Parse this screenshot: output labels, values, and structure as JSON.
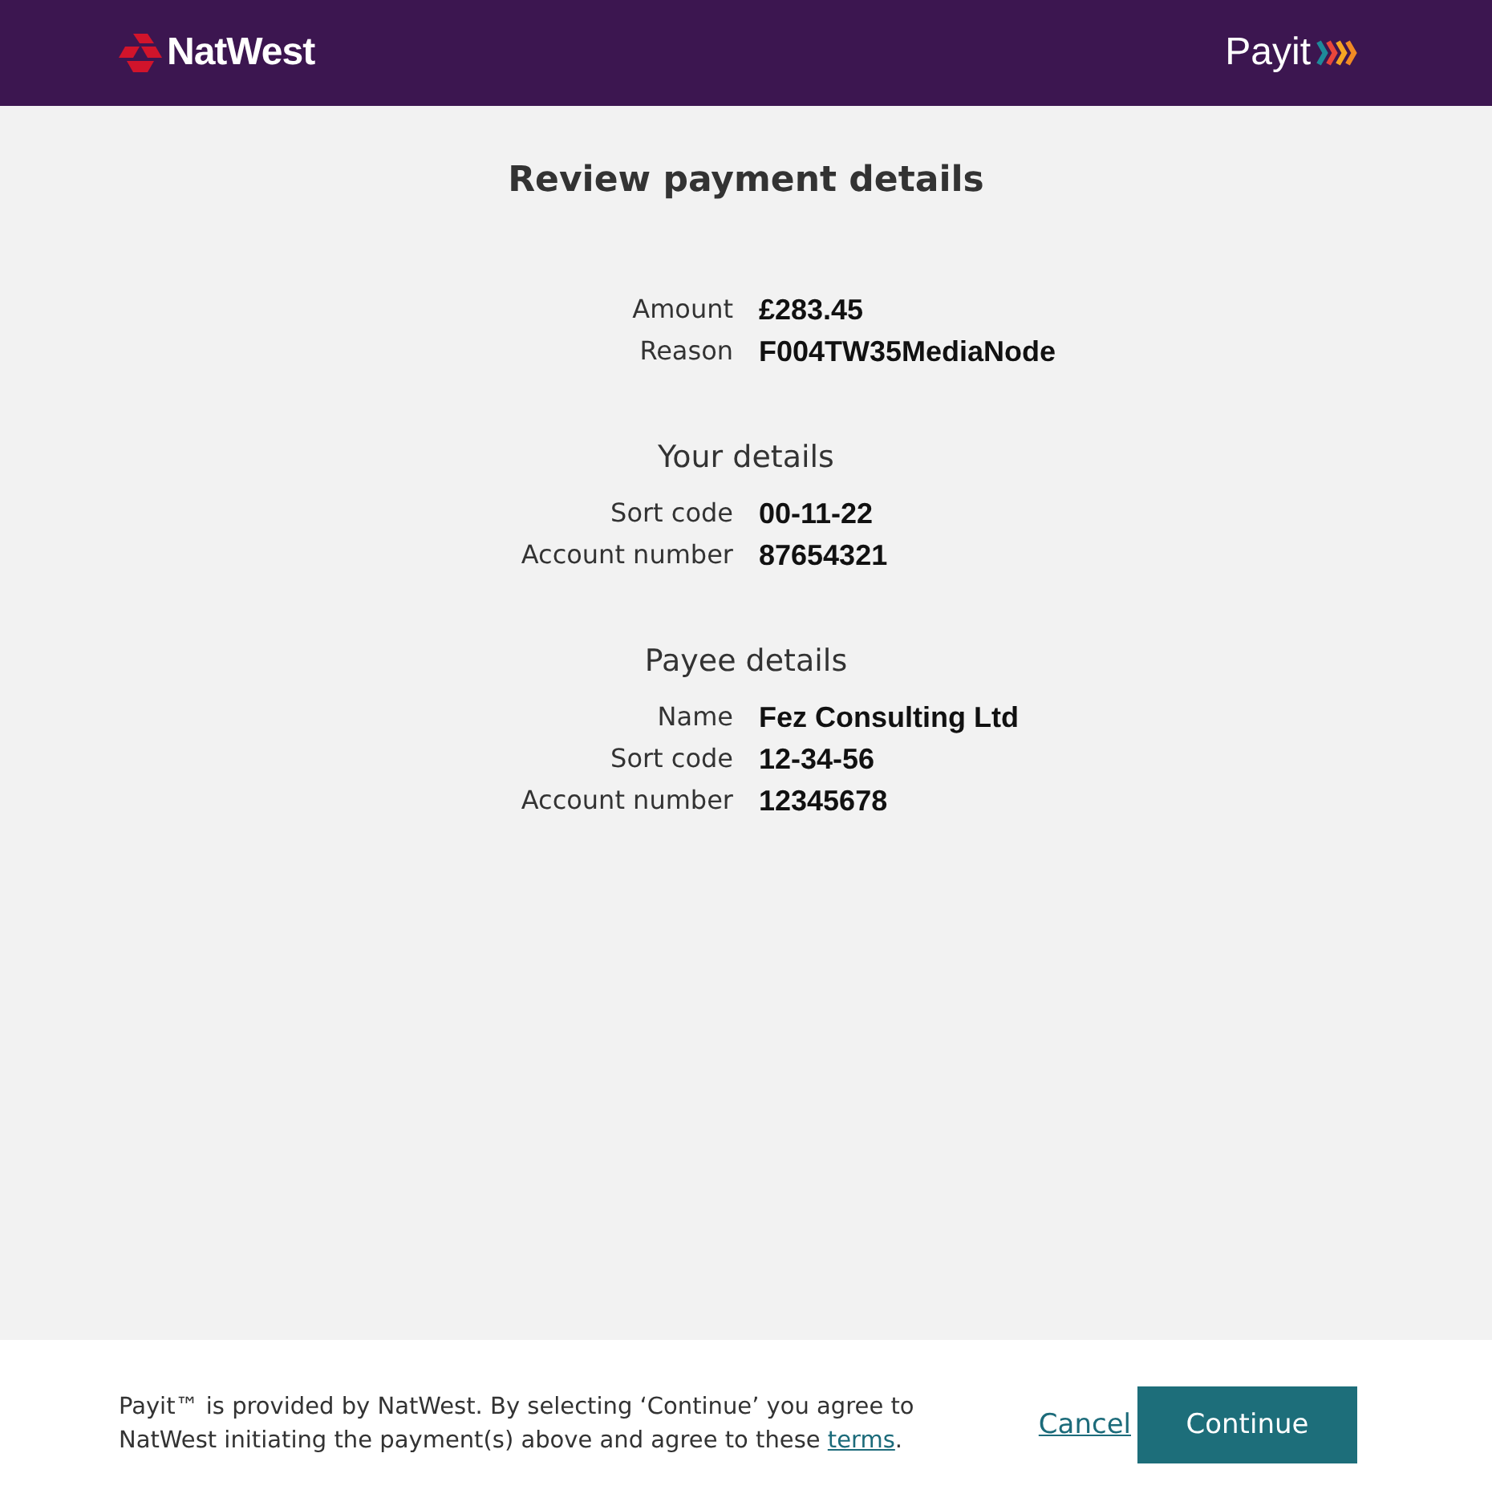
{
  "header": {
    "bank_name": "NatWest",
    "service_name": "Payit"
  },
  "title": "Review payment details",
  "sections": [
    {
      "rows": [
        {
          "label": "Amount",
          "value": "£283.45"
        },
        {
          "label": "Reason",
          "value": "F004TW35MediaNode"
        }
      ]
    },
    {
      "heading": "Your details",
      "rows": [
        {
          "label": "Sort code",
          "value": "00-11-22"
        },
        {
          "label": "Account number",
          "value": "87654321"
        }
      ]
    },
    {
      "heading": "Payee details",
      "rows": [
        {
          "label": "Name",
          "value": "Fez Consulting Ltd"
        },
        {
          "label": "Sort code",
          "value": "12-34-56"
        },
        {
          "label": "Account number",
          "value": "12345678"
        }
      ]
    }
  ],
  "footer": {
    "notice": "Payit™ is provided by NatWest. By selecting ‘Continue’ you agree to NatWest initiating the payment(s) above and agree to these ",
    "notice_link": "terms",
    "notice_end": ".",
    "cancel": "Cancel",
    "continue": "Continue"
  }
}
